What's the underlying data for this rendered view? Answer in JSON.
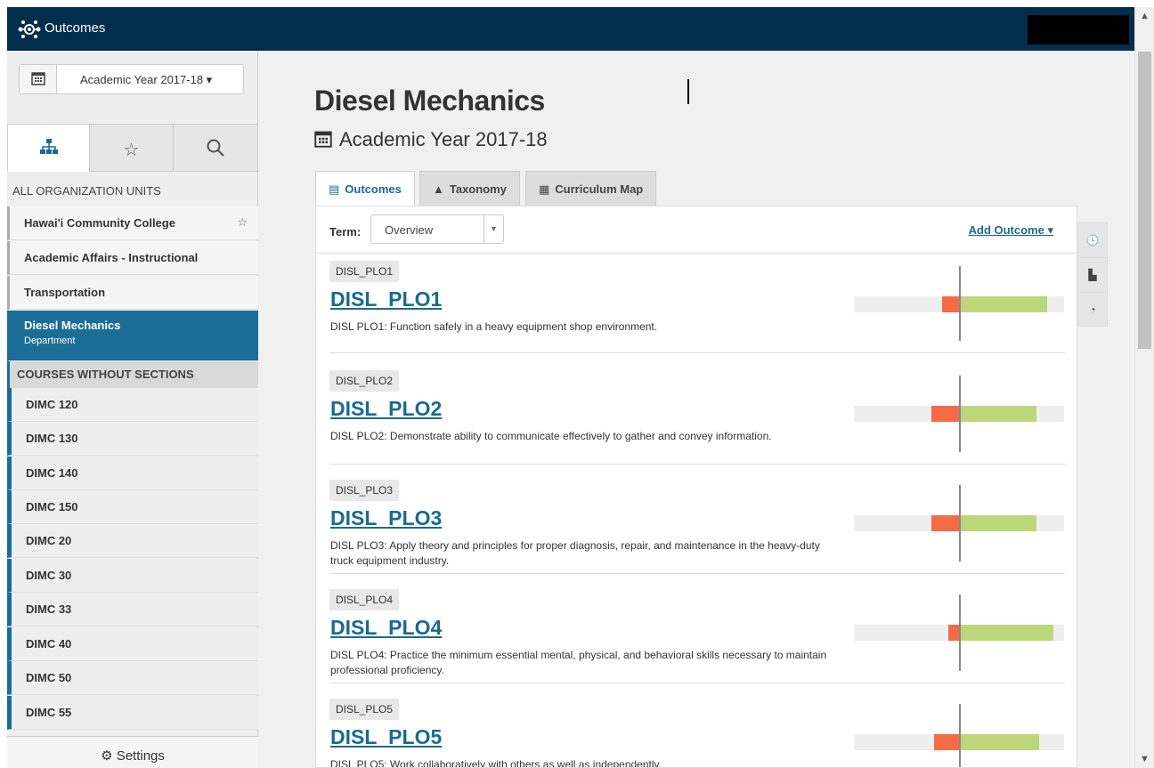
{
  "app": {
    "title": "Outcomes"
  },
  "sidebar": {
    "year_select": "Academic Year 2017-18 ▾",
    "tabs": [
      {
        "name": "hierarchy-icon",
        "active": true
      },
      {
        "name": "star-icon",
        "active": false
      },
      {
        "name": "search-icon",
        "active": false
      }
    ],
    "all_units_label": "ALL ORGANIZATION UNITS",
    "nav": [
      {
        "label": "Hawai'i Community College",
        "star": "☆"
      },
      {
        "label": "Academic Affairs - Instructional"
      },
      {
        "label": "Transportation"
      }
    ],
    "active_item": {
      "label": "Diesel Mechanics",
      "sub": "Department"
    },
    "courses_header": "COURSES WITHOUT SECTIONS",
    "courses": [
      "DIMC 120",
      "DIMC 130",
      "DIMC 140",
      "DIMC 150",
      "DIMC 20",
      "DIMC 30",
      "DIMC 33",
      "DIMC 40",
      "DIMC 50",
      "DIMC 55"
    ],
    "settings_label": "Settings"
  },
  "main": {
    "title": "Diesel Mechanics",
    "subtitle": "Academic Year 2017-18",
    "tabs": [
      {
        "label": "Outcomes",
        "icon": "list-icon"
      },
      {
        "label": "Taxonomy",
        "icon": "triangle-icon"
      },
      {
        "label": "Curriculum Map",
        "icon": "grid-icon"
      }
    ],
    "term_label": "Term:",
    "term_value": "Overview",
    "add_outcome": "Add Outcome ▾",
    "outcomes": [
      {
        "chip": "DISL_PLO1",
        "title": "DISL_PLO1",
        "desc": "DISL PLO1: Function safely in a heavy equipment shop environment.",
        "neg": 0.08,
        "pos": 0.42
      },
      {
        "chip": "DISL_PLO2",
        "title": "DISL_PLO2",
        "desc": "DISL PLO2: Demonstrate ability to communicate effectively to gather and convey information.",
        "neg": 0.13,
        "pos": 0.37
      },
      {
        "chip": "DISL_PLO3",
        "title": "DISL_PLO3",
        "desc": "DISL PLO3: Apply theory and principles for proper diagnosis, repair, and maintenance in the heavy-duty truck equipment industry.",
        "neg": 0.13,
        "pos": 0.37
      },
      {
        "chip": "DISL_PLO4",
        "title": "DISL_PLO4",
        "desc": "DISL PLO4: Practice the minimum essential mental, physical, and behavioral skills necessary to maintain professional proficiency.",
        "neg": 0.05,
        "pos": 0.45
      },
      {
        "chip": "DISL_PLO5",
        "title": "DISL_PLO5",
        "desc": "DISL PLO5: Work collaboratively with others as well as independently.",
        "neg": 0.12,
        "pos": 0.38
      }
    ]
  },
  "side_tools": [
    "clock-icon",
    "bar-chart-icon",
    "gauge-icon"
  ],
  "colors": {
    "topbar": "#032d4d",
    "accent": "#1b6e95",
    "negative": "#f46b45",
    "positive": "#bcd77a"
  }
}
